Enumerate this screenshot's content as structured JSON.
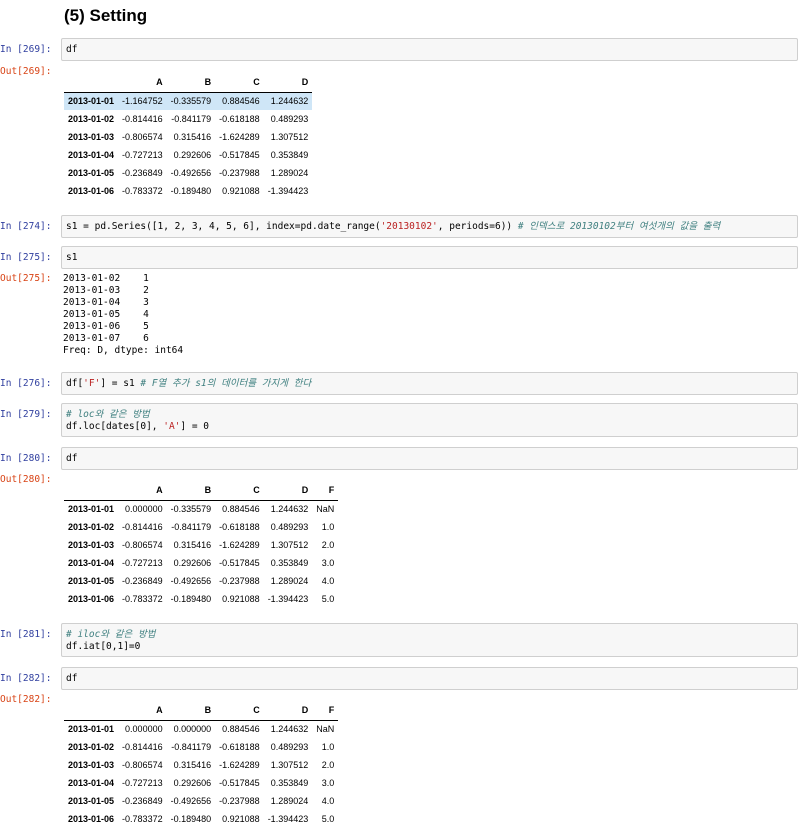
{
  "heading": "(5) Setting",
  "cells": {
    "c269": {
      "in_prompt": "In [269]:",
      "code": "df",
      "out_prompt": "Out[269]:"
    },
    "c274": {
      "in_prompt": "In [274]:",
      "code_a": "s1 = pd.Series([1, 2, 3, 4, 5, 6], index=pd.date_range(",
      "code_b": "'20130102'",
      "code_c": ", periods=6)) ",
      "comment": "# 인덱스로 20130102부터 여섯개의 값을 출력"
    },
    "c275": {
      "in_prompt": "In [275]:",
      "code": "s1",
      "out_prompt": "Out[275]:",
      "output": "2013-01-02    1\n2013-01-03    2\n2013-01-04    3\n2013-01-05    4\n2013-01-06    5\n2013-01-07    6\nFreq: D, dtype: int64"
    },
    "c276": {
      "in_prompt": "In [276]:",
      "code_a": "df[",
      "code_b": "'F'",
      "code_c": "] = s1 ",
      "comment": "# F열 추가 s1의 데이터를 가지게 한다"
    },
    "c279": {
      "in_prompt": "In [279]:",
      "comment": "# loc와 같은 방법",
      "code_a": "df.loc[dates[0], ",
      "code_b": "'A'",
      "code_c": "] = 0"
    },
    "c280": {
      "in_prompt": "In [280]:",
      "code": "df",
      "out_prompt": "Out[280]:"
    },
    "c281": {
      "in_prompt": "In [281]:",
      "comment": "# iloc와 같은 방법",
      "code": "df.iat[0,1]=0"
    },
    "c282": {
      "in_prompt": "In [282]:",
      "code": "df",
      "out_prompt": "Out[282]:"
    }
  },
  "tables": {
    "t269": {
      "columns": [
        "",
        "A",
        "B",
        "C",
        "D"
      ],
      "rows": [
        [
          "2013-01-01",
          "-1.164752",
          "-0.335579",
          "0.884546",
          "1.244632"
        ],
        [
          "2013-01-02",
          "-0.814416",
          "-0.841179",
          "-0.618188",
          "0.489293"
        ],
        [
          "2013-01-03",
          "-0.806574",
          "0.315416",
          "-1.624289",
          "1.307512"
        ],
        [
          "2013-01-04",
          "-0.727213",
          "0.292606",
          "-0.517845",
          "0.353849"
        ],
        [
          "2013-01-05",
          "-0.236849",
          "-0.492656",
          "-0.237988",
          "1.289024"
        ],
        [
          "2013-01-06",
          "-0.783372",
          "-0.189480",
          "0.921088",
          "-1.394423"
        ]
      ]
    },
    "t280": {
      "columns": [
        "",
        "A",
        "B",
        "C",
        "D",
        "F"
      ],
      "rows": [
        [
          "2013-01-01",
          "0.000000",
          "-0.335579",
          "0.884546",
          "1.244632",
          "NaN"
        ],
        [
          "2013-01-02",
          "-0.814416",
          "-0.841179",
          "-0.618188",
          "0.489293",
          "1.0"
        ],
        [
          "2013-01-03",
          "-0.806574",
          "0.315416",
          "-1.624289",
          "1.307512",
          "2.0"
        ],
        [
          "2013-01-04",
          "-0.727213",
          "0.292606",
          "-0.517845",
          "0.353849",
          "3.0"
        ],
        [
          "2013-01-05",
          "-0.236849",
          "-0.492656",
          "-0.237988",
          "1.289024",
          "4.0"
        ],
        [
          "2013-01-06",
          "-0.783372",
          "-0.189480",
          "0.921088",
          "-1.394423",
          "5.0"
        ]
      ]
    },
    "t282": {
      "columns": [
        "",
        "A",
        "B",
        "C",
        "D",
        "F"
      ],
      "rows": [
        [
          "2013-01-01",
          "0.000000",
          "0.000000",
          "0.884546",
          "1.244632",
          "NaN"
        ],
        [
          "2013-01-02",
          "-0.814416",
          "-0.841179",
          "-0.618188",
          "0.489293",
          "1.0"
        ],
        [
          "2013-01-03",
          "-0.806574",
          "0.315416",
          "-1.624289",
          "1.307512",
          "2.0"
        ],
        [
          "2013-01-04",
          "-0.727213",
          "0.292606",
          "-0.517845",
          "0.353849",
          "3.0"
        ],
        [
          "2013-01-05",
          "-0.236849",
          "-0.492656",
          "-0.237988",
          "1.289024",
          "4.0"
        ],
        [
          "2013-01-06",
          "-0.783372",
          "-0.189480",
          "0.921088",
          "-1.394423",
          "5.0"
        ]
      ]
    }
  },
  "colors": {
    "in_prompt": "#303f9f",
    "out_prompt": "#d84315",
    "input_bg": "#f7f7f7",
    "row_highlight": "#cfe6f7",
    "comment": "#408080",
    "string": "#ba2121"
  }
}
